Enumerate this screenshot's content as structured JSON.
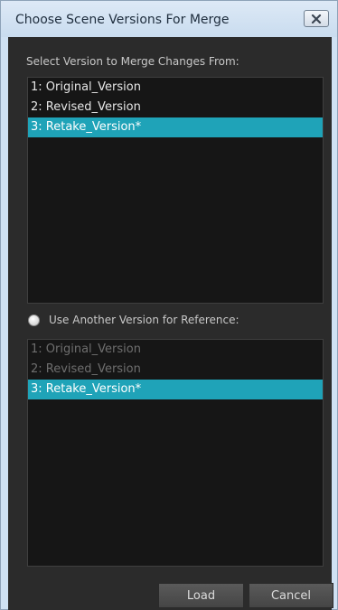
{
  "window": {
    "title": "Choose Scene Versions For Merge"
  },
  "merge_from": {
    "label": "Select Version to Merge Changes From:",
    "items": [
      {
        "label": "1: Original_Version",
        "selected": false
      },
      {
        "label": "2: Revised_Version",
        "selected": false
      },
      {
        "label": "3: Retake_Version*",
        "selected": true
      }
    ]
  },
  "reference": {
    "label": "Use Another Version for Reference:",
    "checked": false,
    "enabled": false,
    "items": [
      {
        "label": "1: Original_Version",
        "selected": false
      },
      {
        "label": "2: Revised_Version",
        "selected": false
      },
      {
        "label": "3: Retake_Version*",
        "selected": true
      }
    ]
  },
  "buttons": {
    "load": "Load",
    "cancel": "Cancel"
  },
  "colors": {
    "selection": "#1fa3b8",
    "panel": "#2b2b2b",
    "list_bg": "#161616",
    "titlebar": "#cfe1f3"
  },
  "icons": {
    "close": "close-icon",
    "radio": "radio-unchecked"
  }
}
